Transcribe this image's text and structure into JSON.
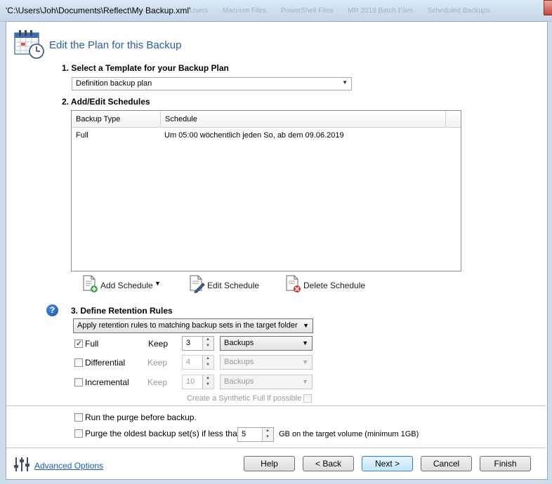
{
  "window": {
    "title": "'C:\\Users\\Joh\\Documents\\Reflect\\My Backup.xml'",
    "background_tabs": [
      "Users",
      "Macrium Files",
      "PowerShell Files",
      "MR 2019 Batch Files",
      "Scheduled Backups"
    ]
  },
  "header": {
    "title": "Edit the Plan for this Backup",
    "icon": "calendar-clock-icon"
  },
  "template": {
    "heading": "1. Select a Template for your Backup Plan",
    "selected": "Definition backup plan"
  },
  "schedules": {
    "heading": "2. Add/Edit Schedules",
    "columns": [
      "Backup Type",
      "Schedule"
    ],
    "rows": [
      {
        "type": "Full",
        "schedule": "Um 05:00 wöchentlich jeden So, ab dem 09.06.2019"
      }
    ],
    "add_label": "Add Schedule",
    "edit_label": "Edit Schedule",
    "delete_label": "Delete Schedule"
  },
  "retention": {
    "heading": "3. Define Retention Rules",
    "mode": "Apply retention rules to matching backup sets in the target folder",
    "keep_label": "Keep",
    "rows": [
      {
        "label": "Full",
        "checked": true,
        "keep": "3",
        "unit": "Backups",
        "enabled": true
      },
      {
        "label": "Differential",
        "checked": false,
        "keep": "4",
        "unit": "Backups",
        "enabled": false
      },
      {
        "label": "Incremental",
        "checked": false,
        "keep": "10",
        "unit": "Backups",
        "enabled": false
      }
    ],
    "synthetic_label": "Create a Synthetic Full if possible"
  },
  "purge": {
    "before_label": "Run the purge before backup.",
    "oldest_label": "Purge the oldest backup set(s) if less than",
    "gb_value": "5",
    "gb_suffix": "GB on the target volume (minimum 1GB)"
  },
  "footer": {
    "advanced_label": "Advanced Options",
    "help_label": "Help",
    "back_label": "< Back",
    "next_label": "Next >",
    "cancel_label": "Cancel",
    "finish_label": "Finish"
  },
  "colors": {
    "title_blue": "#2a5ea8",
    "link_blue": "#1a5bb8",
    "help_icon": "#1b4fa5",
    "delete_red": "#d9342b"
  }
}
